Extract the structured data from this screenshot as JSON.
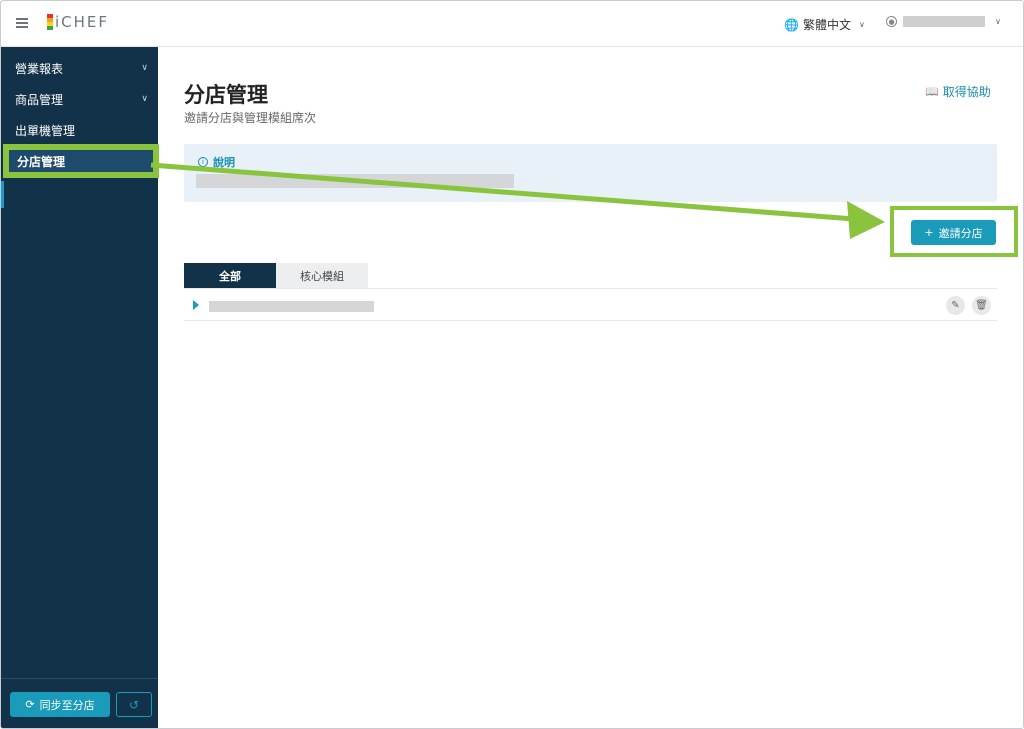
{
  "brand": {
    "logo_text": "iCHEF",
    "logo_colors": [
      "#e5322d",
      "#f6a31b",
      "#f7d21c",
      "#3aa63f"
    ]
  },
  "sidebar": {
    "items": [
      {
        "label": "營業報表",
        "expandable": true
      },
      {
        "label": "商品管理",
        "expandable": true
      },
      {
        "label": "出單機管理",
        "expandable": false
      },
      {
        "label": "分店管理",
        "expandable": false,
        "active": true
      }
    ],
    "sync_label": "同步至分店"
  },
  "topbar": {
    "language": "繁體中文"
  },
  "page": {
    "title": "分店管理",
    "subtitle": "邀請分店與管理模組席次",
    "help_label": "取得協助",
    "info_title": "說明",
    "invite_label": "邀請分店",
    "tabs": [
      {
        "label": "全部",
        "selected": true
      },
      {
        "label": "核心模組",
        "selected": false
      }
    ]
  },
  "colors": {
    "sidebar_bg": "#12324a",
    "accent": "#1a9bb9",
    "highlight": "#8ac43f"
  }
}
